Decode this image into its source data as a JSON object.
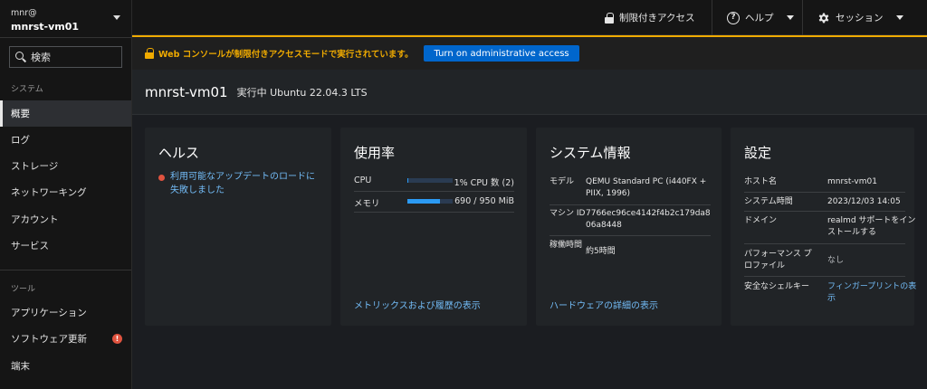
{
  "host": {
    "user": "mnr@",
    "name": "mnrst-vm01"
  },
  "search": {
    "placeholder": "検索"
  },
  "sidebar": {
    "system_label": "システム",
    "system_items": [
      {
        "label": "概要"
      },
      {
        "label": "ログ"
      },
      {
        "label": "ストレージ"
      },
      {
        "label": "ネットワーキング"
      },
      {
        "label": "アカウント"
      },
      {
        "label": "サービス"
      }
    ],
    "tools_label": "ツール",
    "tool_items": [
      {
        "label": "アプリケーション"
      },
      {
        "label": "ソフトウェア更新",
        "badge": "!"
      },
      {
        "label": "端末"
      }
    ]
  },
  "topbar": {
    "limited_access": "制限付きアクセス",
    "help": "ヘルプ",
    "session": "セッション"
  },
  "banner": {
    "text": "Web コンソールが制限付きアクセスモードで実行されています。",
    "button": "Turn on administrative access"
  },
  "page": {
    "title": "mnrst-vm01",
    "subtitle": "実行中 Ubuntu 22.04.3 LTS"
  },
  "health": {
    "title": "ヘルス",
    "alert": "利用可能なアップデートのロードに失敗しました"
  },
  "usage": {
    "title": "使用率",
    "rows": [
      {
        "label": "CPU",
        "value": "1% CPU 数 (2)",
        "fraction": 0.01
      },
      {
        "label": "メモリ",
        "value": "690 / 950 MiB",
        "fraction": 0.726
      }
    ],
    "link": "メトリックスおよび履歴の表示"
  },
  "sysinfo": {
    "title": "システム情報",
    "rows": [
      {
        "key": "モデル",
        "value": "QEMU Standard PC (i440FX + PIIX, 1996)"
      },
      {
        "key": "マシン ID",
        "value": "7766ec96ce4142f4b2c179da806a8448"
      },
      {
        "key": "稼働時間",
        "value": "約5時間"
      }
    ],
    "link": "ハードウェアの詳細の表示"
  },
  "config": {
    "title": "設定",
    "rows": [
      {
        "key": "ホスト名",
        "value": "mnrst-vm01"
      },
      {
        "key": "システム時間",
        "value": "2023/12/03 14:05"
      },
      {
        "key": "ドメイン",
        "value": "realmd サポートをインストールする"
      },
      {
        "key": "パフォーマンス プロファイル",
        "value": "なし"
      },
      {
        "key": "安全なシェルキー",
        "value": "フィンガープリントの表示"
      }
    ]
  },
  "colors": {
    "accent": "#0066cc",
    "warning": "#f0ab00",
    "link": "#73bcf7",
    "danger": "#e0533f"
  }
}
